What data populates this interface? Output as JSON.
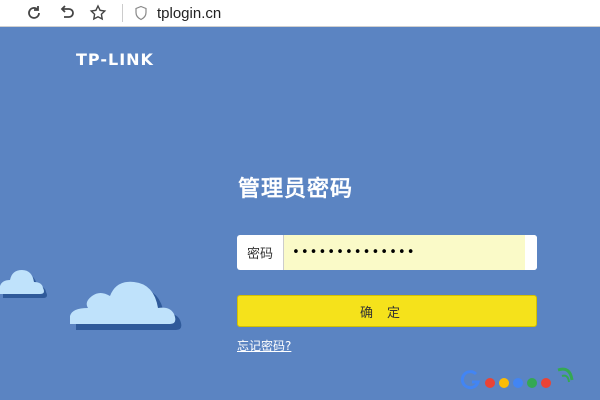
{
  "browser": {
    "address": "tplogin.cn"
  },
  "brand": {
    "logo_text": "TP-LINK"
  },
  "login": {
    "title": "管理员密码",
    "password_label": "密码",
    "password_value": "••••••••••••••",
    "confirm_label": "确定",
    "forgot_link": "忘记密码?"
  },
  "colors": {
    "background": "#5b84c2",
    "confirm_button": "#f5e21b",
    "password_field": "#fafac8",
    "cloud": "#bfe2fb"
  },
  "icons": {
    "reload": "reload-icon",
    "back": "back-icon",
    "bookmark": "star-icon",
    "security": "shield-icon"
  }
}
